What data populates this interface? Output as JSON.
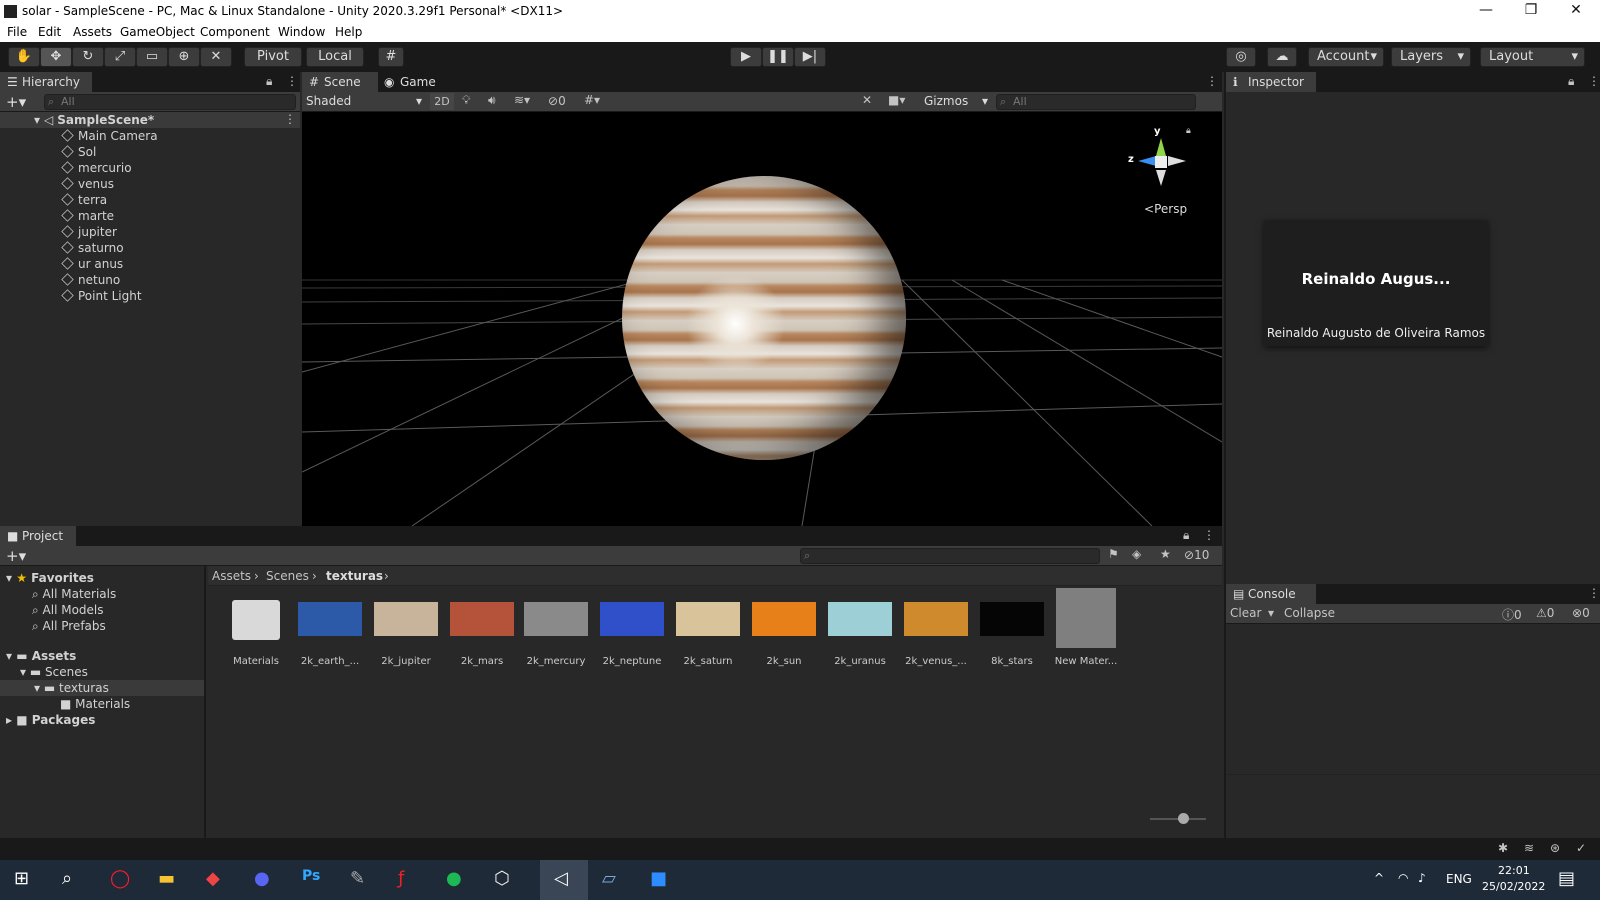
{
  "window": {
    "title": "solar - SampleScene - PC, Mac & Linux Standalone - Unity 2020.3.29f1 Personal* <DX11>",
    "minimize": "—",
    "maximize": "❐",
    "close": "✕"
  },
  "menu": [
    "File",
    "Edit",
    "Assets",
    "GameObject",
    "Component",
    "Window",
    "Help"
  ],
  "toolbar": {
    "pivot": "Pivot",
    "local": "Local",
    "account": "Account",
    "layers": "Layers",
    "layout": "Layout"
  },
  "hierarchy": {
    "tab": "Hierarchy",
    "search_placeholder": "All",
    "scene": "SampleScene*",
    "items": [
      "Main Camera",
      "Sol",
      "mercurio",
      "venus",
      "terra",
      "marte",
      "jupiter",
      "saturno",
      "ur anus",
      "netuno",
      "Point Light"
    ]
  },
  "scene": {
    "tab_scene": "Scene",
    "tab_game": "Game",
    "shading": "Shaded",
    "mode_2d": "2D",
    "hidden_count": "0",
    "gizmos": "Gizmos",
    "search_placeholder": "All",
    "persp": "Persp",
    "axis_y": "y",
    "axis_z": "z"
  },
  "inspector": {
    "tab": "Inspector",
    "card_title": "Reinaldo Augus...",
    "card_name": "Reinaldo Augusto de Oliveira Ramos"
  },
  "project": {
    "tab": "Project",
    "visible_count": "10",
    "favorites": "Favorites",
    "fav_items": [
      "All Materials",
      "All Models",
      "All Prefabs"
    ],
    "assets": "Assets",
    "scenes": "Scenes",
    "texturas": "texturas",
    "materials": "Materials",
    "packages": "Packages",
    "breadcrumb": [
      "Assets",
      "Scenes",
      "texturas"
    ],
    "assets_list": [
      {
        "name": "Materials",
        "color": "#d9d9d9"
      },
      {
        "name": "2k_earth_...",
        "color": "#2d5aa8"
      },
      {
        "name": "2k_jupiter",
        "color": "#c8b49a"
      },
      {
        "name": "2k_mars",
        "color": "#b5533a"
      },
      {
        "name": "2k_mercury",
        "color": "#8a8a8a"
      },
      {
        "name": "2k_neptune",
        "color": "#2f50c8"
      },
      {
        "name": "2k_saturn",
        "color": "#d8c39b"
      },
      {
        "name": "2k_sun",
        "color": "#e8801a"
      },
      {
        "name": "2k_uranus",
        "color": "#9cd0d6"
      },
      {
        "name": "2k_venus_...",
        "color": "#d08a2e"
      },
      {
        "name": "8k_stars",
        "color": "#050505"
      },
      {
        "name": "New Mater...",
        "color": "#7f7f7f"
      }
    ]
  },
  "console": {
    "tab": "Console",
    "clear": "Clear",
    "collapse": "Collapse",
    "info": "0",
    "warn": "0",
    "err": "0"
  },
  "taskbar": {
    "lang": "ENG",
    "time": "22:01",
    "date": "25/02/2022"
  }
}
